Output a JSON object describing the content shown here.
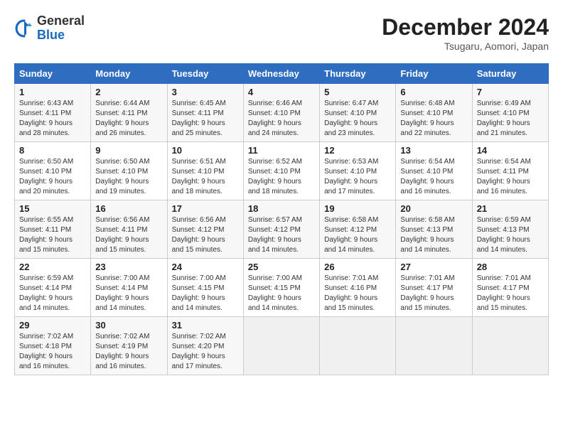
{
  "header": {
    "logo_line1": "General",
    "logo_line2": "Blue",
    "month": "December 2024",
    "location": "Tsugaru, Aomori, Japan"
  },
  "weekdays": [
    "Sunday",
    "Monday",
    "Tuesday",
    "Wednesday",
    "Thursday",
    "Friday",
    "Saturday"
  ],
  "weeks": [
    [
      {
        "day": "1",
        "info": "Sunrise: 6:43 AM\nSunset: 4:11 PM\nDaylight: 9 hours and 28 minutes."
      },
      {
        "day": "2",
        "info": "Sunrise: 6:44 AM\nSunset: 4:11 PM\nDaylight: 9 hours and 26 minutes."
      },
      {
        "day": "3",
        "info": "Sunrise: 6:45 AM\nSunset: 4:11 PM\nDaylight: 9 hours and 25 minutes."
      },
      {
        "day": "4",
        "info": "Sunrise: 6:46 AM\nSunset: 4:10 PM\nDaylight: 9 hours and 24 minutes."
      },
      {
        "day": "5",
        "info": "Sunrise: 6:47 AM\nSunset: 4:10 PM\nDaylight: 9 hours and 23 minutes."
      },
      {
        "day": "6",
        "info": "Sunrise: 6:48 AM\nSunset: 4:10 PM\nDaylight: 9 hours and 22 minutes."
      },
      {
        "day": "7",
        "info": "Sunrise: 6:49 AM\nSunset: 4:10 PM\nDaylight: 9 hours and 21 minutes."
      }
    ],
    [
      {
        "day": "8",
        "info": "Sunrise: 6:50 AM\nSunset: 4:10 PM\nDaylight: 9 hours and 20 minutes."
      },
      {
        "day": "9",
        "info": "Sunrise: 6:50 AM\nSunset: 4:10 PM\nDaylight: 9 hours and 19 minutes."
      },
      {
        "day": "10",
        "info": "Sunrise: 6:51 AM\nSunset: 4:10 PM\nDaylight: 9 hours and 18 minutes."
      },
      {
        "day": "11",
        "info": "Sunrise: 6:52 AM\nSunset: 4:10 PM\nDaylight: 9 hours and 18 minutes."
      },
      {
        "day": "12",
        "info": "Sunrise: 6:53 AM\nSunset: 4:10 PM\nDaylight: 9 hours and 17 minutes."
      },
      {
        "day": "13",
        "info": "Sunrise: 6:54 AM\nSunset: 4:10 PM\nDaylight: 9 hours and 16 minutes."
      },
      {
        "day": "14",
        "info": "Sunrise: 6:54 AM\nSunset: 4:11 PM\nDaylight: 9 hours and 16 minutes."
      }
    ],
    [
      {
        "day": "15",
        "info": "Sunrise: 6:55 AM\nSunset: 4:11 PM\nDaylight: 9 hours and 15 minutes."
      },
      {
        "day": "16",
        "info": "Sunrise: 6:56 AM\nSunset: 4:11 PM\nDaylight: 9 hours and 15 minutes."
      },
      {
        "day": "17",
        "info": "Sunrise: 6:56 AM\nSunset: 4:12 PM\nDaylight: 9 hours and 15 minutes."
      },
      {
        "day": "18",
        "info": "Sunrise: 6:57 AM\nSunset: 4:12 PM\nDaylight: 9 hours and 14 minutes."
      },
      {
        "day": "19",
        "info": "Sunrise: 6:58 AM\nSunset: 4:12 PM\nDaylight: 9 hours and 14 minutes."
      },
      {
        "day": "20",
        "info": "Sunrise: 6:58 AM\nSunset: 4:13 PM\nDaylight: 9 hours and 14 minutes."
      },
      {
        "day": "21",
        "info": "Sunrise: 6:59 AM\nSunset: 4:13 PM\nDaylight: 9 hours and 14 minutes."
      }
    ],
    [
      {
        "day": "22",
        "info": "Sunrise: 6:59 AM\nSunset: 4:14 PM\nDaylight: 9 hours and 14 minutes."
      },
      {
        "day": "23",
        "info": "Sunrise: 7:00 AM\nSunset: 4:14 PM\nDaylight: 9 hours and 14 minutes."
      },
      {
        "day": "24",
        "info": "Sunrise: 7:00 AM\nSunset: 4:15 PM\nDaylight: 9 hours and 14 minutes."
      },
      {
        "day": "25",
        "info": "Sunrise: 7:00 AM\nSunset: 4:15 PM\nDaylight: 9 hours and 14 minutes."
      },
      {
        "day": "26",
        "info": "Sunrise: 7:01 AM\nSunset: 4:16 PM\nDaylight: 9 hours and 15 minutes."
      },
      {
        "day": "27",
        "info": "Sunrise: 7:01 AM\nSunset: 4:17 PM\nDaylight: 9 hours and 15 minutes."
      },
      {
        "day": "28",
        "info": "Sunrise: 7:01 AM\nSunset: 4:17 PM\nDaylight: 9 hours and 15 minutes."
      }
    ],
    [
      {
        "day": "29",
        "info": "Sunrise: 7:02 AM\nSunset: 4:18 PM\nDaylight: 9 hours and 16 minutes."
      },
      {
        "day": "30",
        "info": "Sunrise: 7:02 AM\nSunset: 4:19 PM\nDaylight: 9 hours and 16 minutes."
      },
      {
        "day": "31",
        "info": "Sunrise: 7:02 AM\nSunset: 4:20 PM\nDaylight: 9 hours and 17 minutes."
      },
      null,
      null,
      null,
      null
    ]
  ]
}
